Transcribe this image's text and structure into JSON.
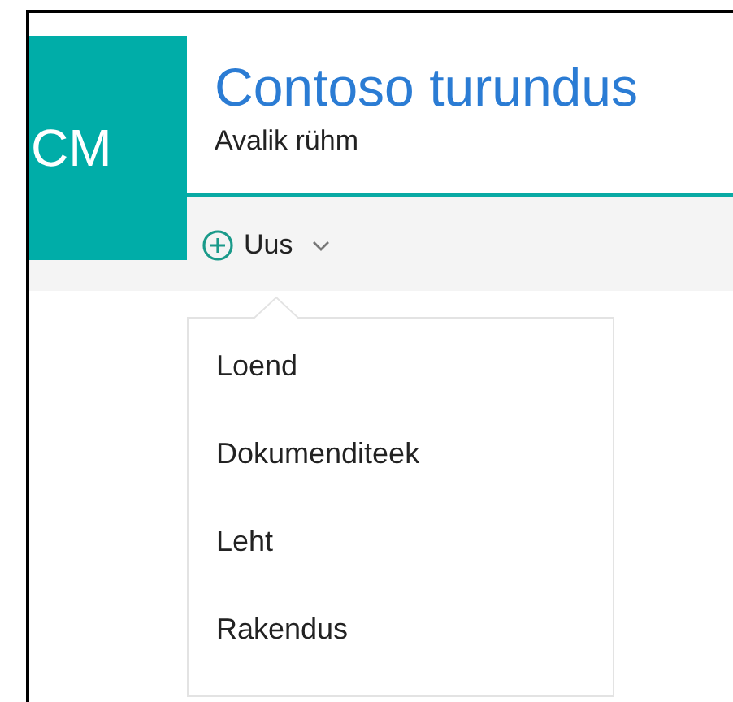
{
  "group": {
    "initials": "CM",
    "title": "Contoso turundus",
    "subtitle": "Avalik rühm"
  },
  "toolbar": {
    "new_button": {
      "label": "Uus"
    }
  },
  "menu": {
    "items": [
      {
        "label": "Loend"
      },
      {
        "label": "Dokumenditeek"
      },
      {
        "label": "Leht"
      },
      {
        "label": "Rakendus"
      }
    ]
  }
}
